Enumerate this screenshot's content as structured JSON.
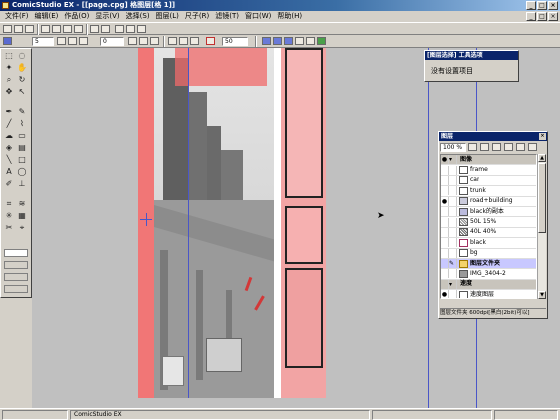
{
  "window": {
    "title": "ComicStudio EX - [[page.cpg] 格图层[格 1]]",
    "controls": [
      "_",
      "□",
      "×"
    ]
  },
  "menubar": {
    "items": [
      "文件(F)",
      "编辑(E)",
      "作品(O)",
      "显示(V)",
      "选择(S)",
      "图层(L)",
      "尺子(R)",
      "滤镜(T)",
      "窗口(W)",
      "帮助(H)"
    ]
  },
  "toolbar": {
    "brush_size": "5",
    "value_a": "0",
    "zoom_value": "50"
  },
  "tool_properties": {
    "title": "[图层选择] 工具选项",
    "message": "没有设置项目"
  },
  "layers_panel": {
    "title": "图层",
    "opacity": "100 %",
    "group_header": "图像",
    "layers": [
      {
        "name": "frame"
      },
      {
        "name": "car"
      },
      {
        "name": "trunk"
      },
      {
        "name": "road+building"
      },
      {
        "name": "black的副本"
      },
      {
        "name": "50L 15%"
      },
      {
        "name": "40L 40%"
      },
      {
        "name": "black"
      },
      {
        "name": "bg"
      },
      {
        "name": "图层文件夹"
      },
      {
        "name": "IMG_3404-2"
      }
    ],
    "speed_header": "速度",
    "speed_layer": "速度图层",
    "status": "图层文件夹 600dpi[黑白(2bit)可以]"
  },
  "statusbar": {
    "app_name": "ComicStudio EX"
  },
  "colors": {
    "titlebar": "#0a246a",
    "accent_red": "#f06a6a",
    "guide_blue": "#4a56c8",
    "selected_layer": "#c8c8ff"
  }
}
